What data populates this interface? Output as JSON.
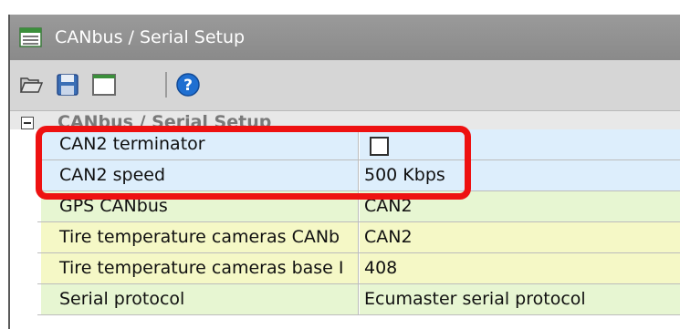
{
  "window": {
    "title": "CANbus / Serial Setup"
  },
  "toolbar": {
    "buttons": [
      {
        "icon": "open-folder-icon"
      },
      {
        "icon": "save-icon"
      },
      {
        "icon": "window-icon"
      },
      {
        "icon": "help-icon"
      }
    ]
  },
  "property_grid": {
    "category_label": "CANbus / Serial Setup",
    "expander_glyph": "−",
    "rows": [
      {
        "name": "CAN2 terminator",
        "value": "",
        "checked": false,
        "style": "blue"
      },
      {
        "name": "CAN2 speed",
        "value": "500 Kbps",
        "style": "blue"
      },
      {
        "name": "GPS CANbus",
        "value": "CAN2",
        "style": "green"
      },
      {
        "name": "Tire temperature cameras CANb",
        "value": "CAN2",
        "style": "yellow"
      },
      {
        "name": "Tire temperature cameras base I",
        "value": "408",
        "style": "yellow"
      },
      {
        "name": "Serial protocol",
        "value": "Ecumaster serial protocol",
        "style": "green"
      }
    ]
  },
  "colors": {
    "highlight": "#ee1111",
    "titlebar": "#8f8f8f",
    "help_icon": "#1f6fd1"
  }
}
